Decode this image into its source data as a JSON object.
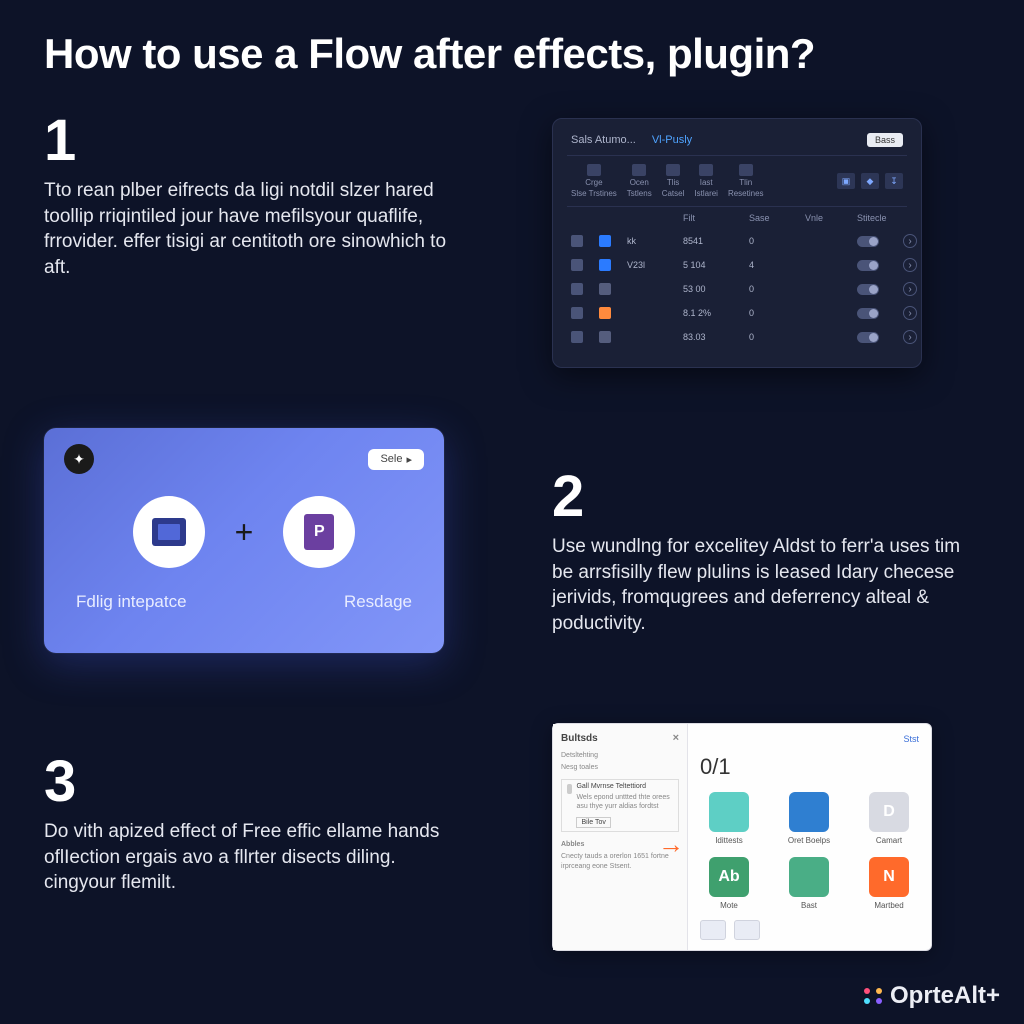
{
  "title": "How to use a Flow after effects, plugin?",
  "steps": {
    "s1": {
      "num": "1",
      "text": "Tto rean plber eifrects da ligi notdil slzer hared toollip rriqintiled jour have mefilsyour quaflife, frrovider. effer tisigi ar centitoth ore sinowhich to aft."
    },
    "s2": {
      "num": "2",
      "text": "Use wundlng for excelitey Aldst to ferr'a uses tim be arrsfisilly flew plulins is leased Idary checese jerivids, fromqugrees and deferrency alteal & poductivity."
    },
    "s3": {
      "num": "3",
      "text": "Do vith apized effect of Free effic ellame hands oflIection ergais avo a fllrter disects diling. cingyour flemilt."
    }
  },
  "panel1": {
    "tab1": "Sals Atumo...",
    "tab2": "Vl-Pusly",
    "badge": "Bass",
    "tb": [
      "Crge",
      "Ocen",
      "Tlis",
      "Iast",
      "Tlin"
    ],
    "tb2": [
      "Slse Trstines",
      "Tstlens",
      "Catsel",
      "Istlarei",
      "Resetines"
    ],
    "head": {
      "c1": "Filt",
      "c2": "Sase",
      "c3": "Vnle",
      "c4": "Stitecle"
    },
    "rows": [
      {
        "name": "kk",
        "v1": "8541",
        "v2": "0",
        "v3": ""
      },
      {
        "name": "V23l",
        "v1": "5 104",
        "v2": "4",
        "v3": ""
      },
      {
        "name": "",
        "v1": "53 00",
        "v2": "0",
        "v3": ""
      },
      {
        "name": "",
        "v1": "8.1 2%",
        "v2": "0",
        "v3": ""
      },
      {
        "name": "",
        "v1": "83.03",
        "v2": "0",
        "v3": ""
      }
    ]
  },
  "panel2": {
    "chip": "Sele",
    "label1": "Fdlig intepatce",
    "label2": "Resdage",
    "p_letter": "P"
  },
  "panel3": {
    "title": "Bultsds",
    "topright": "Stst",
    "sub1": "Detsltehting",
    "sub2": "Nesg toales",
    "line1": "Gall Mvrnse Teltettiord",
    "line2": "Wels epond unttted thte orees asu thye yurr aldias fordtst",
    "btn": "Bile Tov",
    "line3": "Abbles",
    "line4": "Cnecty tauds a orerlon 1651 fortne irprceang eone Stsent.",
    "big": "0/1",
    "tiles": [
      {
        "label": "Idittests",
        "cls": "t-teal",
        "glyph": ""
      },
      {
        "label": "Oret Boelps",
        "cls": "t-blue",
        "glyph": ""
      },
      {
        "label": "Camart",
        "cls": "t-grey",
        "glyph": "D"
      },
      {
        "label": "Mote",
        "cls": "t-green",
        "glyph": "Ab"
      },
      {
        "label": "Bast",
        "cls": "t-green2",
        "glyph": ""
      },
      {
        "label": "Martbed",
        "cls": "t-orange",
        "glyph": "N"
      }
    ]
  },
  "brand": "OprteAlt+"
}
